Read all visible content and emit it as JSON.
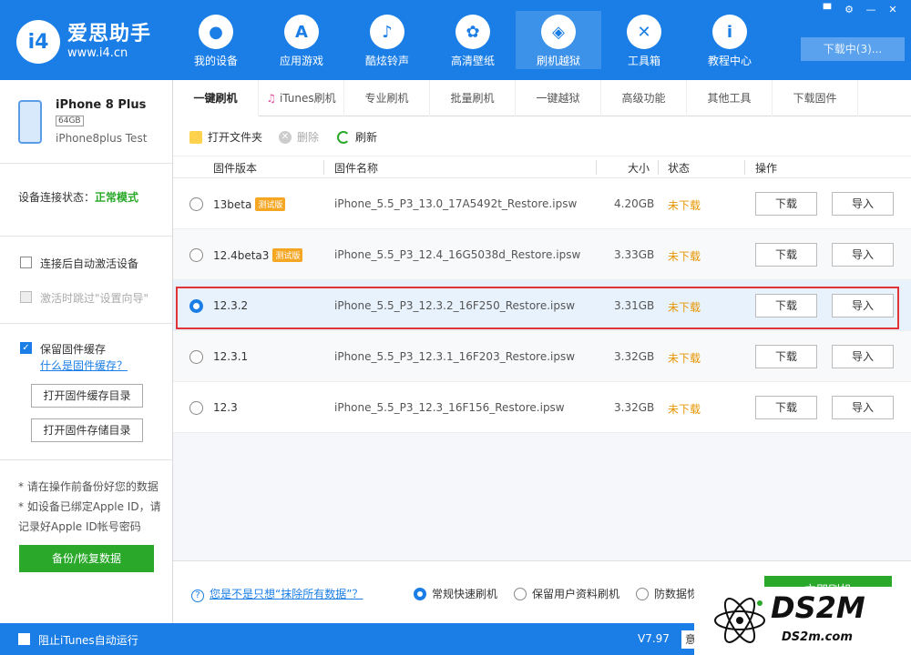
{
  "brand": {
    "name": "爱思助手",
    "url": "www.i4.cn",
    "badge": "i4"
  },
  "nav": [
    {
      "label": "我的设备",
      "icon": ""
    },
    {
      "label": "应用游戏",
      "icon": "A"
    },
    {
      "label": "酷炫铃声",
      "icon": "♪"
    },
    {
      "label": "高清壁纸",
      "icon": "✿"
    },
    {
      "label": "刷机越狱",
      "icon": "◈"
    },
    {
      "label": "工具箱",
      "icon": "✕"
    },
    {
      "label": "教程中心",
      "icon": "i"
    }
  ],
  "window_controls": [
    "▀",
    "⚙",
    "—",
    "✕"
  ],
  "download_label": "下载中(3)...",
  "device": {
    "name": "iPhone 8 Plus",
    "capacity": "64GB",
    "subtitle": "iPhone8plus Test"
  },
  "connection": {
    "label": "设备连接状态：",
    "value": "正常模式"
  },
  "options": {
    "auto_activate": "连接后自动激活设备",
    "skip_setup": "激活时跳过\"设置向导\"",
    "keep_cache": "保留固件缓存",
    "what_is_cache": "什么是固件缓存？",
    "open_cache_dir": "打开固件缓存目录",
    "open_store_dir": "打开固件存储目录"
  },
  "notes": [
    "* 请在操作前备份好您的数据",
    "* 如设备已绑定Apple ID，请记录好Apple ID帐号密码"
  ],
  "backup_label": "备份/恢复数据",
  "tabs": [
    "一键刷机",
    "iTunes刷机",
    "专业刷机",
    "批量刷机",
    "一键越狱",
    "高级功能",
    "其他工具",
    "下载固件"
  ],
  "toolbar": {
    "open_folder": "打开文件夹",
    "delete": "删除",
    "refresh": "刷新"
  },
  "columns": {
    "version": "固件版本",
    "name": "固件名称",
    "size": "大小",
    "status": "状态",
    "action": "操作"
  },
  "firmware": [
    {
      "version": "13beta",
      "beta": "测试版",
      "name": "iPhone_5.5_P3_13.0_17A5492t_Restore.ipsw",
      "size": "4.20GB",
      "status": "未下载",
      "selected": false
    },
    {
      "version": "12.4beta3",
      "beta": "测试版",
      "name": "iPhone_5.5_P3_12.4_16G5038d_Restore.ipsw",
      "size": "3.33GB",
      "status": "未下载",
      "selected": false
    },
    {
      "version": "12.3.2",
      "beta": "",
      "name": "iPhone_5.5_P3_12.3.2_16F250_Restore.ipsw",
      "size": "3.31GB",
      "status": "未下载",
      "selected": true
    },
    {
      "version": "12.3.1",
      "beta": "",
      "name": "iPhone_5.5_P3_12.3.1_16F203_Restore.ipsw",
      "size": "3.32GB",
      "status": "未下载",
      "selected": false
    },
    {
      "version": "12.3",
      "beta": "",
      "name": "iPhone_5.5_P3_12.3_16F156_Restore.ipsw",
      "size": "3.32GB",
      "status": "未下载",
      "selected": false
    }
  ],
  "row_buttons": {
    "download": "下载",
    "import": "导入"
  },
  "footer": {
    "question": "您是不是只想“抹除所有数据”？",
    "mode_fast": "常规快速刷机",
    "mode_keep": "保留用户资料刷机",
    "mode_anti": "防数据恢复刷机",
    "start": "立即刷机"
  },
  "statusbar": {
    "block_itunes": "阻止iTunes自动运行",
    "version": "V7.97",
    "cut": "意"
  },
  "watermark": {
    "big": "DS2M",
    "small": "DS2m.com"
  }
}
